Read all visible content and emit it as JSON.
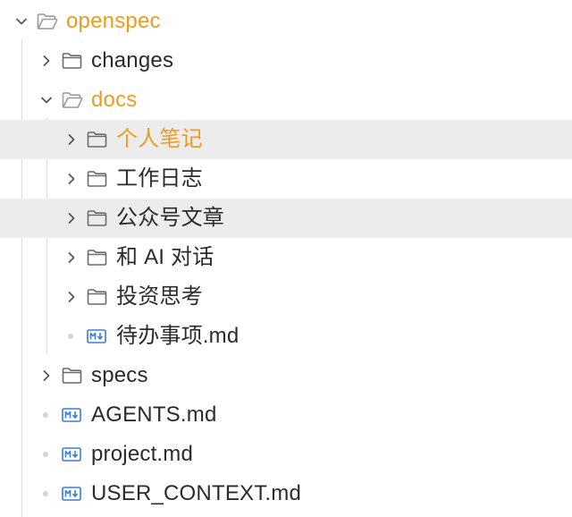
{
  "tree": {
    "root": {
      "label": "openspec",
      "expanded": true
    },
    "changes": {
      "label": "changes"
    },
    "docs": {
      "label": "docs",
      "expanded": true
    },
    "docs_children": [
      {
        "label": "个人笔记"
      },
      {
        "label": "工作日志"
      },
      {
        "label": "公众号文章"
      },
      {
        "label": "和 AI 对话"
      },
      {
        "label": "投资思考"
      },
      {
        "label": "待办事项.md"
      }
    ],
    "specs": {
      "label": "specs"
    },
    "files": [
      {
        "label": "AGENTS.md"
      },
      {
        "label": "project.md"
      },
      {
        "label": "USER_CONTEXT.md"
      }
    ]
  },
  "colors": {
    "active": "#eb9d1f",
    "text": "#2b2b2b",
    "selection": "#ececec",
    "markdown_icon": "#3b7dd8"
  },
  "icons": {
    "folder_open": "folder-open-icon",
    "folder_closed": "folder-icon",
    "markdown": "markdown-icon",
    "chevron_down": "chevron-down-icon",
    "chevron_right": "chevron-right-icon"
  }
}
